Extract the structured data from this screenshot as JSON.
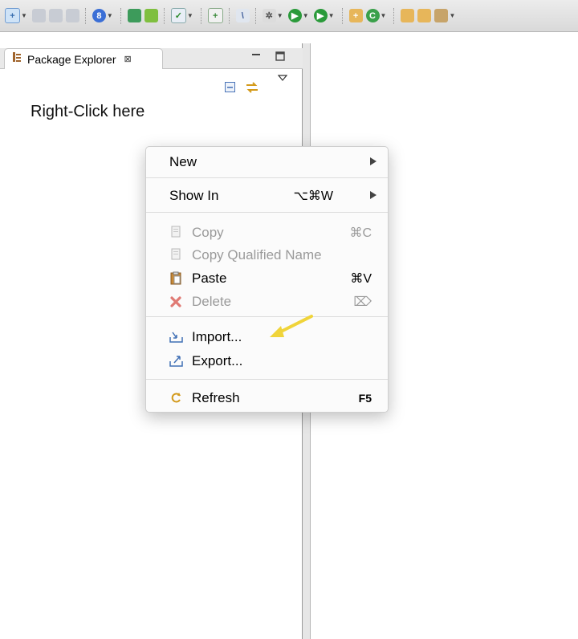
{
  "view": {
    "tab_title": "Package Explorer",
    "close_glyph": "⊠",
    "hint_text": "Right-Click here"
  },
  "context_menu": {
    "items": [
      {
        "label": "New",
        "shortcut": "",
        "submenu": true,
        "enabled": true
      },
      {
        "label": "Show In",
        "shortcut": "⌥⌘W",
        "submenu": true,
        "enabled": true
      },
      {
        "label": "Copy",
        "shortcut": "⌘C",
        "enabled": false,
        "icon": "copy-icon"
      },
      {
        "label": "Copy Qualified Name",
        "shortcut": "",
        "enabled": false,
        "icon": "copy-qualified-name-icon"
      },
      {
        "label": "Paste",
        "shortcut": "⌘V",
        "enabled": true,
        "icon": "paste-icon"
      },
      {
        "label": "Delete",
        "shortcut": "⌦",
        "enabled": false,
        "icon": "delete-icon"
      },
      {
        "label": "Import...",
        "shortcut": "",
        "enabled": true,
        "icon": "import-icon"
      },
      {
        "label": "Export...",
        "shortcut": "",
        "enabled": true,
        "icon": "export-icon"
      },
      {
        "label": "Refresh",
        "shortcut": "F5",
        "enabled": true,
        "icon": "refresh-icon"
      }
    ]
  },
  "colors": {
    "annotation_arrow": "#f0d43a",
    "delete_icon": "#d9534f",
    "toolbar_bg": "#dddddd"
  }
}
